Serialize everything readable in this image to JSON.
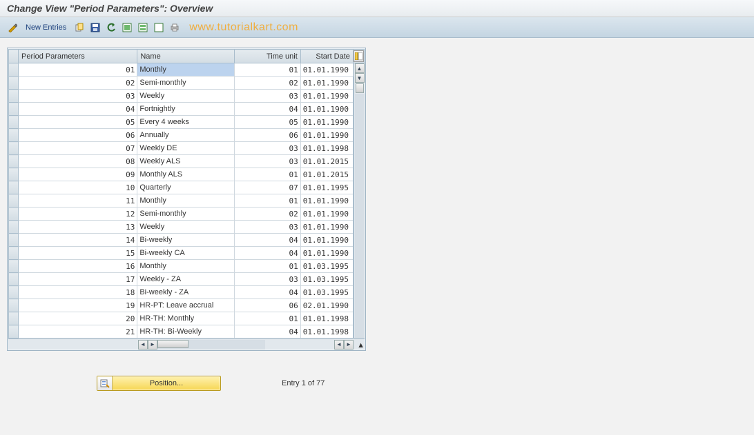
{
  "title": "Change View \"Period Parameters\": Overview",
  "toolbar": {
    "new_entries": "New Entries"
  },
  "watermark": "www.tutorialkart.com",
  "columns": {
    "pp": "Period Parameters",
    "name": "Name",
    "tu": "Time unit",
    "sd": "Start Date"
  },
  "rows": [
    {
      "pp": "01",
      "name": "Monthly",
      "tu": "01",
      "sd": "01.01.1990",
      "selected": true
    },
    {
      "pp": "02",
      "name": "Semi-monthly",
      "tu": "02",
      "sd": "01.01.1990"
    },
    {
      "pp": "03",
      "name": "Weekly",
      "tu": "03",
      "sd": "01.01.1990"
    },
    {
      "pp": "04",
      "name": "Fortnightly",
      "tu": "04",
      "sd": "01.01.1900"
    },
    {
      "pp": "05",
      "name": "Every 4 weeks",
      "tu": "05",
      "sd": "01.01.1990"
    },
    {
      "pp": "06",
      "name": "Annually",
      "tu": "06",
      "sd": "01.01.1990"
    },
    {
      "pp": "07",
      "name": "Weekly  DE",
      "tu": "03",
      "sd": "01.01.1998"
    },
    {
      "pp": "08",
      "name": "Weekly ALS",
      "tu": "03",
      "sd": "01.01.2015"
    },
    {
      "pp": "09",
      "name": "Monthly ALS",
      "tu": "01",
      "sd": "01.01.2015"
    },
    {
      "pp": "10",
      "name": "Quarterly",
      "tu": "07",
      "sd": "01.01.1995"
    },
    {
      "pp": "11",
      "name": "Monthly",
      "tu": "01",
      "sd": "01.01.1990"
    },
    {
      "pp": "12",
      "name": "Semi-monthly",
      "tu": "02",
      "sd": "01.01.1990"
    },
    {
      "pp": "13",
      "name": "Weekly",
      "tu": "03",
      "sd": "01.01.1990"
    },
    {
      "pp": "14",
      "name": "Bi-weekly",
      "tu": "04",
      "sd": "01.01.1990"
    },
    {
      "pp": "15",
      "name": "Bi-weekly CA",
      "tu": "04",
      "sd": "01.01.1990"
    },
    {
      "pp": "16",
      "name": "Monthly",
      "tu": "01",
      "sd": "01.03.1995"
    },
    {
      "pp": "17",
      "name": "Weekly - ZA",
      "tu": "03",
      "sd": "01.03.1995"
    },
    {
      "pp": "18",
      "name": "Bi-weekly - ZA",
      "tu": "04",
      "sd": "01.03.1995"
    },
    {
      "pp": "19",
      "name": "HR-PT: Leave accrual",
      "tu": "06",
      "sd": "02.01.1990"
    },
    {
      "pp": "20",
      "name": "HR-TH: Monthly",
      "tu": "01",
      "sd": "01.01.1998"
    },
    {
      "pp": "21",
      "name": "HR-TH: Bi-Weekly",
      "tu": "04",
      "sd": "01.01.1998"
    }
  ],
  "footer": {
    "position_label": "Position...",
    "entry_text": "Entry 1 of 77"
  }
}
